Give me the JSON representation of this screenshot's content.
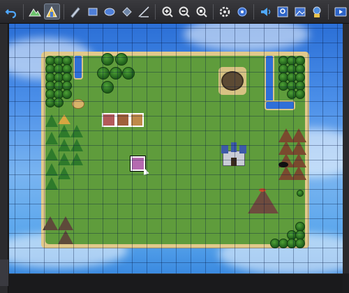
{
  "toolbar": {
    "buttons": [
      {
        "icon": "undo-icon"
      },
      {
        "icon": "map-mode-icon"
      },
      {
        "icon": "event-mode-icon",
        "active": true
      },
      {
        "icon": "pencil-icon"
      },
      {
        "icon": "rectangle-icon"
      },
      {
        "icon": "ellipse-icon"
      },
      {
        "icon": "fill-icon"
      },
      {
        "icon": "shadow-pen-icon"
      },
      {
        "icon": "zoom-in-icon"
      },
      {
        "icon": "zoom-out-icon"
      },
      {
        "icon": "zoom-actual-icon"
      },
      {
        "icon": "database-icon"
      },
      {
        "icon": "plugin-icon"
      },
      {
        "icon": "sound-test-icon"
      },
      {
        "icon": "event-search-icon"
      },
      {
        "icon": "resource-manager-icon"
      },
      {
        "icon": "character-generator-icon"
      },
      {
        "icon": "playtest-icon"
      }
    ]
  },
  "map": {
    "colors": {
      "sea": "#4a8ee8",
      "sand": "#e1c98b",
      "grass": "#5f9c3c",
      "water": "#2f6fd8"
    }
  }
}
